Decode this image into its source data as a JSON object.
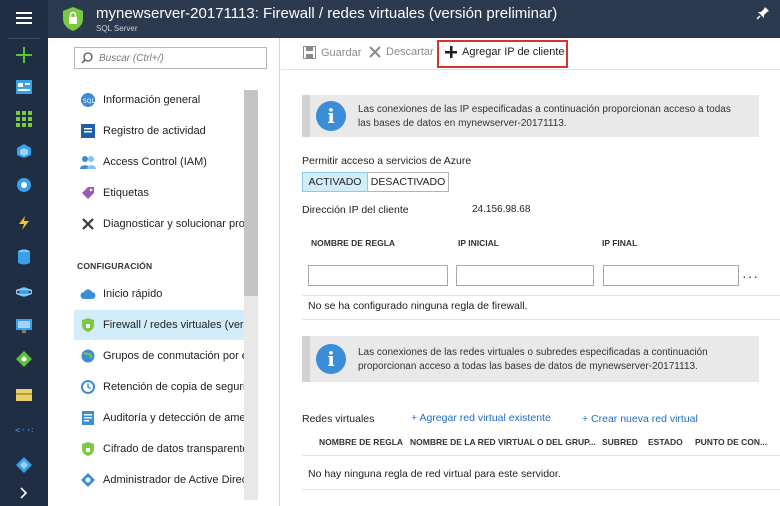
{
  "header": {
    "title": "mynewserver-20171113: Firewall / redes virtuales (versión preliminar)",
    "subtitle": "SQL Server"
  },
  "search": {
    "placeholder": "Buscar (Ctrl+/)"
  },
  "menu": {
    "items": [
      {
        "label": "Información general"
      },
      {
        "label": "Registro de actividad"
      },
      {
        "label": "Access Control (IAM)"
      },
      {
        "label": "Etiquetas"
      },
      {
        "label": "Diagnosticar y solucionar pro..."
      }
    ],
    "section_label": "CONFIGURACIÓN",
    "config_items": [
      {
        "label": "Inicio rápido"
      },
      {
        "label": "Firewall / redes virtuales (vers..."
      },
      {
        "label": "Grupos de conmutación por e..."
      },
      {
        "label": "Retención de copia de seguri..."
      },
      {
        "label": "Auditoría y detección de ame..."
      },
      {
        "label": "Cifrado de datos transparente"
      },
      {
        "label": "Administrador de Active Direc..."
      }
    ]
  },
  "toolbar": {
    "save_label": "Guardar",
    "discard_label": "Descartar",
    "add_client_ip_label": "Agregar IP de cliente"
  },
  "firewall": {
    "info_text": "Las conexiones de las IP especificadas a continuación proporcionan acceso a todas las bases de datos en mynewserver-20171113.",
    "allow_azure_label": "Permitir acceso a servicios de Azure",
    "toggle_on": "ACTIVADO",
    "toggle_off": "DESACTIVADO",
    "client_ip_label": "Dirección IP del cliente",
    "client_ip_value": "24.156.98.68",
    "columns": [
      "NOMBRE DE REGLA",
      "IP INICIAL",
      "IP FINAL"
    ],
    "empty_message": "No se ha configurado ninguna regla de firewall."
  },
  "vnet": {
    "info_text": "Las conexiones de las redes virtuales o subredes especificadas a continuación proporcionan acceso a todas las bases de datos de mynewserver-20171113.",
    "section_label": "Redes virtuales",
    "add_existing_label": "+ Agregar red virtual existente",
    "create_new_label": "+ Crear nueva red virtual",
    "columns": [
      "NOMBRE DE REGLA",
      "NOMBRE DE LA RED VIRTUAL O DEL GRUP...",
      "SUBRED",
      "ESTADO",
      "PUNTO DE CON..."
    ],
    "empty_message": "No hay ninguna regla de red virtual para este servidor."
  },
  "colors": {
    "rail": "#1f2e44",
    "header": "#2b3a4f",
    "accent_blue": "#3a8dd6",
    "highlight_red": "#d6332e",
    "active_item": "#d2ecfa"
  }
}
